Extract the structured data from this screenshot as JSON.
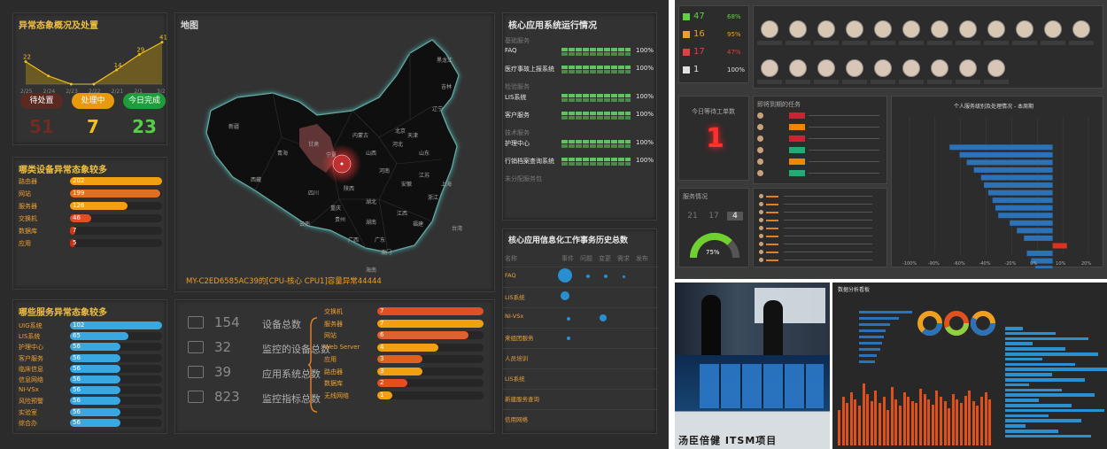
{
  "main": {
    "anomaly": {
      "title": "异常态象概况及处置",
      "chart_data": {
        "type": "area",
        "series": [
          {
            "values": [
              22,
              8,
              0,
              0,
              14,
              29,
              41
            ]
          }
        ],
        "labels": [
          "22",
          "",
          "",
          "",
          "14",
          "29",
          "41"
        ],
        "x": [
          "2/25",
          "2/24",
          "2/23",
          "2/22",
          "2/21",
          "2/1",
          "3/2"
        ],
        "ylim": [
          0,
          45
        ]
      },
      "pills": [
        {
          "label": "待处置",
          "color": "#5a2a22"
        },
        {
          "label": "处理中",
          "color": "#e89a0c"
        },
        {
          "label": "今日完成",
          "color": "#1e9e3a"
        }
      ],
      "counts": [
        {
          "value": "51",
          "color": "#6e2c22"
        },
        {
          "value": "7",
          "color": "#f0c020"
        },
        {
          "value": "23",
          "color": "#54d046"
        }
      ]
    },
    "map": {
      "title": "地图",
      "alert": "MY-C2ED6585AC39的[CPU-核心 CPU1]容量异常44444",
      "provinces": [
        "新疆",
        "西藏",
        "青海",
        "甘肃",
        "内蒙古",
        "宁夏",
        "陕西",
        "四川",
        "云南",
        "贵州",
        "重庆",
        "湖北",
        "湖南",
        "广西",
        "广东",
        "河南",
        "山西",
        "河北",
        "北京",
        "天津",
        "山东",
        "辽宁",
        "吉林",
        "黑龙江",
        "江苏",
        "安徽",
        "浙江",
        "江西",
        "福建",
        "台湾",
        "海南",
        "上海",
        "澳门"
      ]
    },
    "devices": {
      "title": "哪类设备异常态象较多",
      "chart_data": {
        "type": "bar",
        "categories": [
          "路由器",
          "网站",
          "服务器",
          "交换机",
          "数据库",
          "应用"
        ],
        "values": [
          202,
          199,
          126,
          46,
          7,
          5
        ],
        "xlim": [
          0,
          202
        ]
      },
      "colors": [
        "#f0a010",
        "#e07020",
        "#f0a010",
        "#e05020",
        "#d03818",
        "#c83010"
      ]
    },
    "services": {
      "title": "哪些服务异常态象较多",
      "chart_data": {
        "type": "bar",
        "categories": [
          "UIG系统",
          "LIS系统",
          "护理中心",
          "客户服务",
          "临床信息",
          "信息网络",
          "NI-VSx",
          "风险预警",
          "实验室",
          "综合办"
        ],
        "values": [
          102,
          65,
          56,
          56,
          56,
          56,
          56,
          56,
          56,
          56
        ],
        "xlim": [
          0,
          102
        ]
      }
    },
    "systems": {
      "title": "核心应用系统运行情况",
      "groups": [
        {
          "label": "基础服务",
          "rows": [
            {
              "name": "FAQ",
              "pct": "100%"
            },
            {
              "name": "医疗事故上报系统",
              "pct": "100%"
            }
          ]
        },
        {
          "label": "检验服务",
          "rows": [
            {
              "name": "LIS系统",
              "pct": "100%"
            },
            {
              "name": "客户服务",
              "pct": "100%"
            }
          ]
        },
        {
          "label": "技术服务",
          "rows": [
            {
              "name": "护理中心",
              "pct": "100%"
            },
            {
              "name": "行销档案查询系统",
              "pct": "100%"
            }
          ]
        }
      ],
      "footer": "未分配服务包"
    },
    "stats": {
      "items": [
        {
          "num": "154",
          "label": "设备总数"
        },
        {
          "num": "32",
          "label": "监控的设备总数"
        },
        {
          "num": "39",
          "label": "应用系统总数"
        },
        {
          "num": "823",
          "label": "监控指标总数"
        }
      ],
      "chart_data": {
        "type": "bar",
        "categories": [
          "交换机",
          "服务器",
          "网站",
          "Web Server",
          "应用",
          "路由器",
          "数据库",
          "无线网络"
        ],
        "values": [
          7,
          7,
          6,
          4,
          3,
          3,
          2,
          1
        ],
        "xlim": [
          0,
          7
        ]
      },
      "colors": [
        "#e05020",
        "#f0a010",
        "#e06030",
        "#f0a010",
        "#e06020",
        "#f0a010",
        "#e05020",
        "#f0a010"
      ]
    },
    "history": {
      "title": "核心应用信息化工作事务历史总数",
      "cols": [
        "名称",
        "事件",
        "问题",
        "变更",
        "需求",
        "发布"
      ],
      "rows": [
        "FAQ",
        "LIS系统",
        "NI-VSx",
        "来组团服务",
        "人员培训",
        "LIS系统",
        "新建服务查询",
        "信用网络"
      ]
    }
  },
  "rt": {
    "stats": [
      {
        "num": "47",
        "pct": "68%",
        "color": "#5fd040"
      },
      {
        "num": "16",
        "pct": "95%",
        "color": "#f0a020"
      },
      {
        "num": "17",
        "pct": "47%",
        "color": "#e04040"
      },
      {
        "num": "1",
        "pct": "100%",
        "color": "#e0e0e0"
      }
    ],
    "sla_title": "今日等待工单数",
    "sla_value": "1",
    "tasks_title": "即将到期的任务",
    "satisfaction_title": "服务情况",
    "sat_vals": [
      "21",
      "17",
      "4"
    ],
    "gauge": "75%",
    "chart_title": "个人服务级别及处理情况 - 本周期",
    "chart_data": {
      "type": "bar",
      "values": [
        -72,
        -65,
        -60,
        -55,
        -50,
        -48,
        -45,
        -42,
        -40,
        -38,
        -30,
        -25,
        -20,
        10,
        -18,
        -15,
        -12,
        -10
      ],
      "xlim": [
        -100,
        25
      ],
      "ticks": [
        "-100%",
        "-90%",
        "-60%",
        "-40%",
        "-20%",
        "0%",
        "10%",
        "20%"
      ]
    }
  },
  "photo_caption": "汤臣倍健 ITSM项目",
  "rb": {
    "title": "数据分析看板"
  }
}
